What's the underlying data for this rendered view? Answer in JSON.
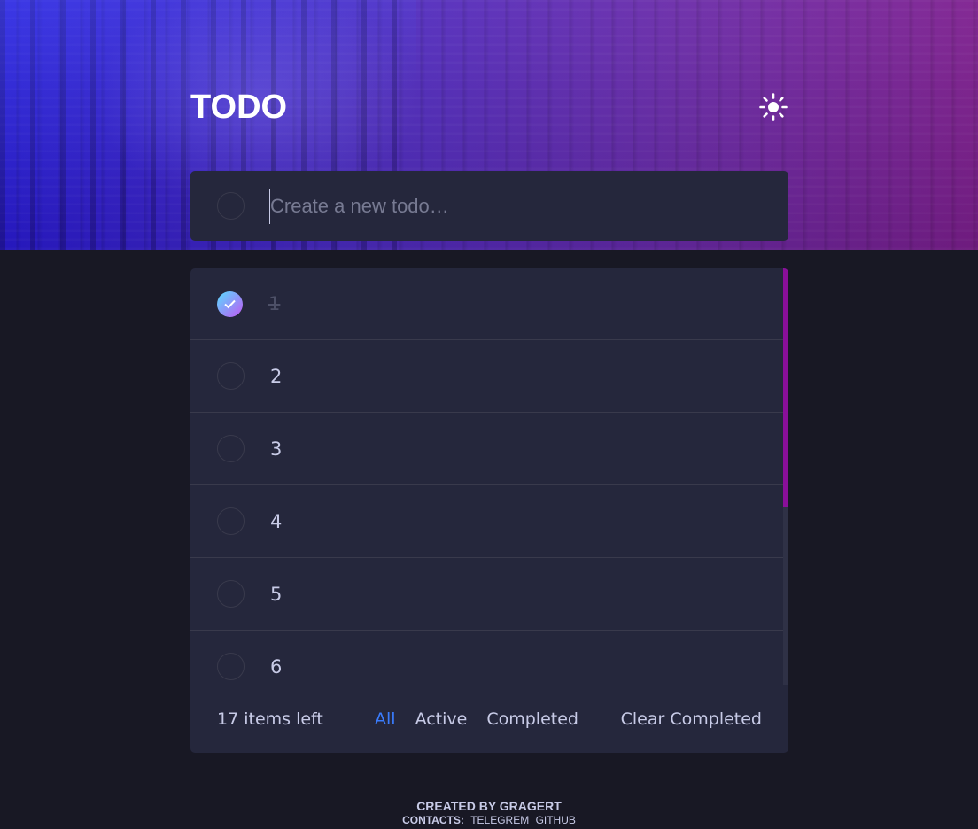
{
  "header": {
    "title": "TODO",
    "theme_icon": "sun-icon"
  },
  "new_todo": {
    "placeholder": "Create a new todo…",
    "value": ""
  },
  "todos": [
    {
      "label": "1",
      "completed": true
    },
    {
      "label": "2",
      "completed": false
    },
    {
      "label": "3",
      "completed": false
    },
    {
      "label": "4",
      "completed": false
    },
    {
      "label": "5",
      "completed": false
    },
    {
      "label": "6",
      "completed": false
    }
  ],
  "footer": {
    "items_left": "17 items left",
    "filters": [
      "All",
      "Active",
      "Completed"
    ],
    "active_filter": "All",
    "clear_label": "Clear Completed"
  },
  "credits": {
    "created_by": "CREATED BY GRAGERT",
    "contacts_label": "CONTACTS:",
    "links": [
      "TELEGREM",
      "GITHUB"
    ]
  },
  "colors": {
    "background": "#181824",
    "card": "#25273c",
    "accent": "#3a7cfd",
    "scroll_thumb": "#8a0f9a"
  }
}
